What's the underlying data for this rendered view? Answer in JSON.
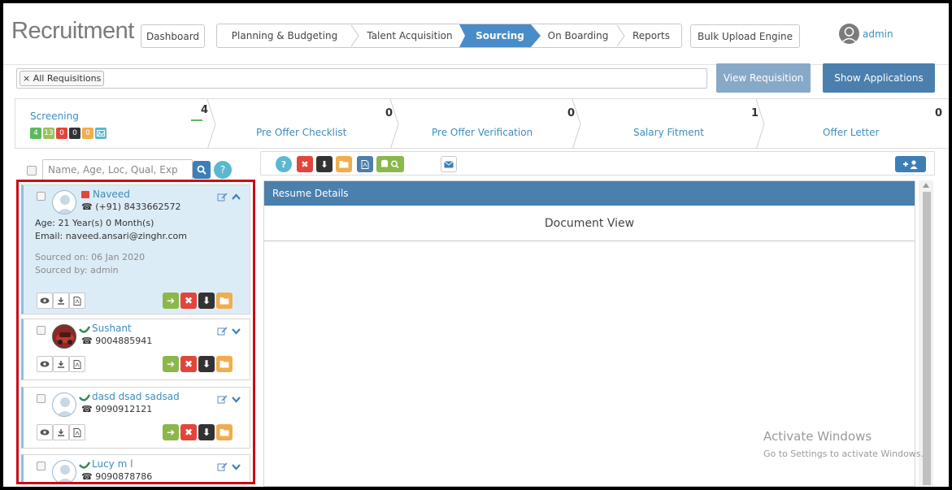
{
  "app": {
    "title": "Recruitment"
  },
  "header": {
    "dashboard_label": "Dashboard",
    "steps": [
      {
        "label": "Planning & Budgeting"
      },
      {
        "label": "Talent Acquisition"
      },
      {
        "label": "Sourcing"
      },
      {
        "label": "On Boarding"
      },
      {
        "label": "Reports"
      }
    ],
    "active_step": "Sourcing",
    "bulk_upload_label": "Bulk Upload Engine",
    "user_name": "admin"
  },
  "filter": {
    "tag_label": "× All Requisitions"
  },
  "actions": {
    "view_requisition": "View Requisition",
    "show_applications": "Show Applications"
  },
  "pipeline": {
    "stages": [
      {
        "label": "Screening",
        "count": "4"
      },
      {
        "label": "Pre Offer Checklist",
        "count": "0"
      },
      {
        "label": "Pre Offer Verification",
        "count": "0"
      },
      {
        "label": "Salary Fitment",
        "count": "1"
      },
      {
        "label": "Offer Letter",
        "count": "0"
      }
    ],
    "screening_badges": [
      {
        "value": "4",
        "color": "#5cb85c"
      },
      {
        "value": "13",
        "color": "#9ac35b"
      },
      {
        "value": "0",
        "color": "#e2453c"
      },
      {
        "value": "0",
        "color": "#333333"
      },
      {
        "value": "0",
        "color": "#f0ad4e"
      }
    ]
  },
  "search": {
    "placeholder": "Name, Age, Loc, Qual, Exp"
  },
  "candidates": [
    {
      "name": "Naveed",
      "phone": "(+91) 8433662572",
      "age_label": "Age:",
      "age": "21 Year(s) 0 Month(s)",
      "email_label": "Email:",
      "email": "naveed.ansari@zinghr.com",
      "sourced_on": "Sourced on: 06 Jan 2020",
      "sourced_by": "Sourced by: admin"
    },
    {
      "name": "Sushant",
      "phone": "9004885941"
    },
    {
      "name": "dasd dsad sadsad",
      "phone": "9090912121"
    },
    {
      "name": "Lucy m l",
      "phone": "9090878786"
    }
  ],
  "resume": {
    "header": "Resume Details",
    "document_title": "Document View"
  },
  "watermark": {
    "line1": "Activate Windows",
    "line2": "Go to Settings to activate Windows."
  },
  "colors": {
    "primary": "#4a8cc7",
    "view_requisition_bg": "#87a9c8",
    "show_applications_bg": "#4a7fae",
    "highlight_border": "#cc0a14"
  }
}
